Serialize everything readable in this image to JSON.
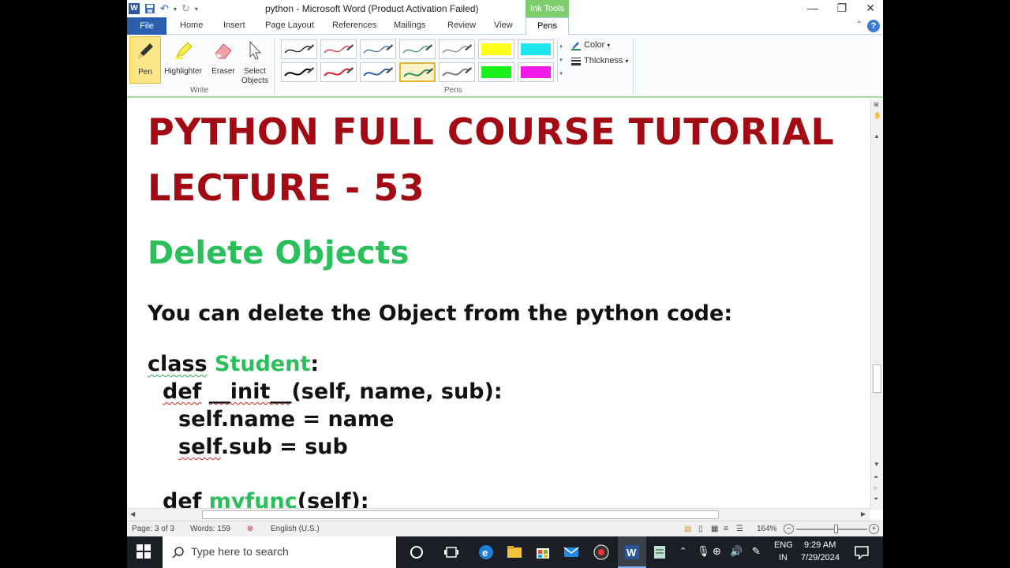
{
  "window": {
    "title": "python  -  Microsoft Word (Product Activation Failed)",
    "contextual_tab": "Ink Tools",
    "minimize": "—",
    "restore": "❐",
    "close": "✕"
  },
  "tabs": [
    "File",
    "Home",
    "Insert",
    "Page Layout",
    "References",
    "Mailings",
    "Review",
    "View",
    "Pens"
  ],
  "ribbon": {
    "write_group": {
      "label": "Write",
      "buttons": [
        {
          "label": "Pen"
        },
        {
          "label": "Highlighter"
        },
        {
          "label": "Eraser"
        },
        {
          "label": "Select Objects"
        }
      ]
    },
    "pens_group": {
      "label": "Pens",
      "pens": [
        {
          "color": "#000000",
          "highlighter": false
        },
        {
          "color": "#e21b2c",
          "highlighter": false
        },
        {
          "color": "#2f5fb3",
          "highlighter": false
        },
        {
          "color": "#2e8b57",
          "highlighter": false
        },
        {
          "color": "#7a7a7a",
          "highlighter": false
        },
        {
          "color": "#ffff1a",
          "highlighter": true
        },
        {
          "color": "#1ee6ef",
          "highlighter": true
        },
        {
          "color": "#000000",
          "highlighter": false
        },
        {
          "color": "#e21b2c",
          "highlighter": false
        },
        {
          "color": "#2f5fb3",
          "highlighter": false
        },
        {
          "color": "#2e8b57",
          "highlighter": false,
          "selected": true
        },
        {
          "color": "#7a7a7a",
          "highlighter": false
        },
        {
          "color": "#1bef1b",
          "highlighter": true
        },
        {
          "color": "#f01be8",
          "highlighter": true
        }
      ]
    },
    "color_label": "Color",
    "thickness_label": "Thickness"
  },
  "document": {
    "title_line1": "PYTHON FULL COURSE TUTORIAL",
    "title_line2": "LECTURE - 53",
    "heading": "Delete Objects",
    "intro": "You can delete the Object from the python code:",
    "code": {
      "l1_kw": "class",
      "l1_name": "Student",
      "l1_colon": ":",
      "l2_def": "def",
      "l2_init": "__init__",
      "l2_args": "(self, name, sub):",
      "l3_self": "self",
      "l3_rest": ".name = name",
      "l4_self": "self",
      "l4_rest": ".sub = sub",
      "l5_def": "def",
      "l5_name": "myfunc",
      "l5_args": "(self):"
    }
  },
  "statusbar": {
    "page": "Page: 3 of 3",
    "words": "Words: 159",
    "language": "English (U.S.)",
    "zoom": "164%"
  },
  "taskbar": {
    "search_placeholder": "Type here to search",
    "lang_top": "ENG",
    "lang_bottom": "IN",
    "time": "9:29 AM",
    "date": "7/29/2024"
  }
}
